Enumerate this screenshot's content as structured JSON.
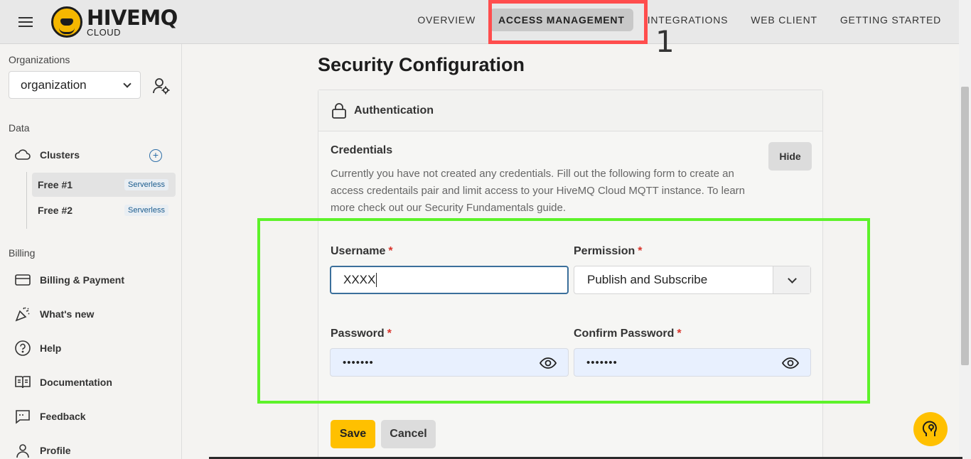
{
  "header": {
    "logo_main": "HIVEMQ",
    "logo_sub": "CLOUD",
    "nav": [
      {
        "label": "OVERVIEW",
        "active": false
      },
      {
        "label": "ACCESS MANAGEMENT",
        "active": true
      },
      {
        "label": "INTEGRATIONS",
        "active": false
      },
      {
        "label": "WEB CLIENT",
        "active": false
      },
      {
        "label": "GETTING STARTED",
        "active": false
      }
    ],
    "annotation_number": "1"
  },
  "sidebar": {
    "organizations_label": "Organizations",
    "organization_value": "organization",
    "data_label": "Data",
    "clusters_label": "Clusters",
    "clusters": [
      {
        "name": "Free #1",
        "badge": "Serverless",
        "selected": true
      },
      {
        "name": "Free #2",
        "badge": "Serverless",
        "selected": false
      }
    ],
    "billing_label": "Billing",
    "items": [
      {
        "label": "Billing & Payment",
        "icon": "credit-card-icon"
      },
      {
        "label": "What's new",
        "icon": "confetti-icon"
      },
      {
        "label": "Help",
        "icon": "help-circle-icon"
      },
      {
        "label": "Documentation",
        "icon": "book-icon"
      },
      {
        "label": "Feedback",
        "icon": "feedback-icon"
      },
      {
        "label": "Profile",
        "icon": "user-icon"
      }
    ]
  },
  "main": {
    "page_title": "Security Configuration",
    "auth_title": "Authentication",
    "credentials_title": "Credentials",
    "credentials_desc": "Currently you have not created any credentials. Fill out the following form to create an access credentails pair and limit access to your HiveMQ Cloud MQTT instance. To learn more check out our Security Fundamentals guide.",
    "hide_label": "Hide",
    "username_label": "Username",
    "username_value": "XXXX",
    "permission_label": "Permission",
    "permission_value": "Publish and Subscribe",
    "password_label": "Password",
    "password_value": "•••••••",
    "confirm_label": "Confirm Password",
    "confirm_value": "•••••••",
    "required_mark": "*",
    "save_label": "Save",
    "cancel_label": "Cancel"
  },
  "colors": {
    "accent": "#ffc000",
    "annotation_red": "#ff4d4d",
    "annotation_green": "#5df22a",
    "link_blue": "#2f6fa8"
  }
}
